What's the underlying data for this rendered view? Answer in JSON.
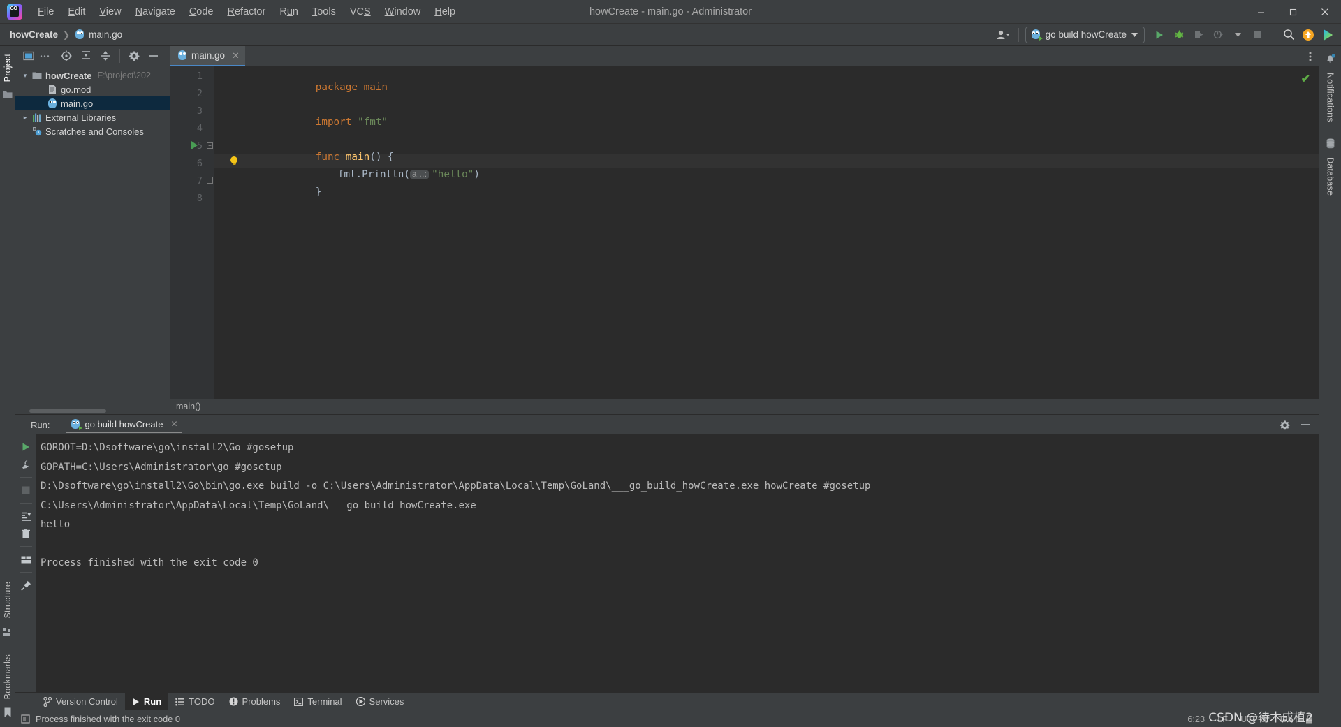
{
  "window": {
    "title": "howCreate - main.go - Administrator",
    "controls": {
      "minimize": "—",
      "maximize": "❐",
      "close": "✕"
    }
  },
  "menubar": {
    "logo_text": "GO",
    "items": [
      {
        "label": "File",
        "mnemonic": "F"
      },
      {
        "label": "Edit",
        "mnemonic": "E"
      },
      {
        "label": "View",
        "mnemonic": "V"
      },
      {
        "label": "Navigate",
        "mnemonic": "N"
      },
      {
        "label": "Code",
        "mnemonic": "C"
      },
      {
        "label": "Refactor",
        "mnemonic": "R"
      },
      {
        "label": "Run",
        "mnemonic": "u"
      },
      {
        "label": "Tools",
        "mnemonic": "T"
      },
      {
        "label": "VCS",
        "mnemonic": "S"
      },
      {
        "label": "Window",
        "mnemonic": "W"
      },
      {
        "label": "Help",
        "mnemonic": "H"
      }
    ]
  },
  "navbar": {
    "breadcrumbs": [
      {
        "label": "howCreate",
        "icon": "none"
      },
      {
        "label": "main.go",
        "icon": "go-file-icon"
      }
    ],
    "run_configuration": {
      "label": "go build howCreate",
      "icon": "go-run-config-icon"
    },
    "actions": [
      "account-icon",
      "run-icon",
      "debug-icon",
      "run-with-coverage-icon",
      "profile-icon",
      "stop-icon",
      "search-everywhere-icon",
      "update-icon",
      "ide-features-icon"
    ]
  },
  "left_stripe": {
    "top": [
      {
        "label": "Project",
        "active": true,
        "icon": "project-icon"
      }
    ],
    "bottom": [
      {
        "label": "Structure",
        "icon": "structure-icon"
      },
      {
        "label": "Bookmarks",
        "icon": "bookmarks-icon"
      }
    ]
  },
  "right_stripe": {
    "items": [
      {
        "label": "Notifications",
        "icon": "bell-icon",
        "badge": true
      },
      {
        "label": "Database",
        "icon": "database-icon"
      }
    ]
  },
  "project_panel": {
    "toolbar": [
      "select-opened-file-icon",
      "ellipsis-icon",
      "scroll-from-source-icon",
      "expand-all-icon",
      "collapse-all-icon",
      "settings-icon",
      "hide-icon"
    ],
    "tree": [
      {
        "label": "howCreate",
        "path": "F:\\project\\202",
        "icon": "folder-icon",
        "indent": 0,
        "expanded": true,
        "bold": true,
        "selected": false
      },
      {
        "label": "go.mod",
        "path": "",
        "icon": "go-mod-icon",
        "indent": 1,
        "expanded": null,
        "bold": false,
        "selected": false
      },
      {
        "label": "main.go",
        "path": "",
        "icon": "go-file-icon",
        "indent": 1,
        "expanded": null,
        "bold": false,
        "selected": true
      },
      {
        "label": "External Libraries",
        "path": "",
        "icon": "libraries-icon",
        "indent": 0,
        "expanded": false,
        "bold": false,
        "selected": false
      },
      {
        "label": "Scratches and Consoles",
        "path": "",
        "icon": "scratches-icon",
        "indent": 0,
        "expanded": null,
        "bold": false,
        "selected": false
      }
    ]
  },
  "editor": {
    "tab": {
      "label": "main.go",
      "icon": "go-file-icon",
      "close": "✕"
    },
    "more_icon": "more-vertical-icon",
    "inspection_status": "✔",
    "breadcrumb": "main()",
    "line_numbers": [
      "1",
      "2",
      "3",
      "4",
      "5",
      "6",
      "7",
      "8"
    ],
    "lines": [
      {
        "n": 1,
        "tokens": [
          {
            "t": "package ",
            "c": "kw"
          },
          {
            "t": "main",
            "c": "kw"
          }
        ]
      },
      {
        "n": 2,
        "tokens": []
      },
      {
        "n": 3,
        "tokens": [
          {
            "t": "import ",
            "c": "kw"
          },
          {
            "t": "\"fmt\"",
            "c": "str"
          }
        ]
      },
      {
        "n": 4,
        "tokens": []
      },
      {
        "n": 5,
        "tokens": [
          {
            "t": "func ",
            "c": "kw"
          },
          {
            "t": "main",
            "c": "fn"
          },
          {
            "t": "() {",
            "c": "pl"
          }
        ]
      },
      {
        "n": 6,
        "tokens": [
          {
            "t": "    fmt.Println(",
            "c": "id"
          },
          {
            "t": " a…: ",
            "c": "hint"
          },
          {
            "t": "\"hello\"",
            "c": "str"
          },
          {
            "t": ")",
            "c": "pl"
          }
        ]
      },
      {
        "n": 7,
        "tokens": [
          {
            "t": "}",
            "c": "pl"
          }
        ]
      },
      {
        "n": 8,
        "tokens": []
      }
    ],
    "code_text": {
      "l1": "package main",
      "l3_kw": "import ",
      "l3_str": "\"fmt\"",
      "l5_kw": "func ",
      "l5_fn": "main",
      "l5_pl": "() {",
      "l6_pre": "fmt.Println(",
      "l6_hint": "a…:",
      "l6_str": "\"hello\"",
      "l6_post": ")",
      "l7": "}"
    }
  },
  "run_panel": {
    "label": "Run:",
    "tab": {
      "label": "go build howCreate",
      "icon": "go-run-config-icon",
      "close": "✕"
    },
    "header_actions": [
      "settings-icon",
      "hide-icon"
    ],
    "gutter_actions": [
      "rerun-icon",
      "wrench-icon",
      "stop-icon",
      "scroll-to-end-icon",
      "trash-icon",
      "soft-wrap-icon",
      "pin-icon"
    ],
    "console_lines": [
      "GOROOT=D:\\Dsoftware\\go\\install2\\Go #gosetup",
      "GOPATH=C:\\Users\\Administrator\\go #gosetup",
      "D:\\Dsoftware\\go\\install2\\Go\\bin\\go.exe build -o C:\\Users\\Administrator\\AppData\\Local\\Temp\\GoLand\\___go_build_howCreate.exe howCreate #gosetup",
      "C:\\Users\\Administrator\\AppData\\Local\\Temp\\GoLand\\___go_build_howCreate.exe",
      "hello",
      "",
      "Process finished with the exit code 0"
    ]
  },
  "tool_tabs": [
    {
      "label": "Version Control",
      "icon": "branch-icon",
      "active": false
    },
    {
      "label": "Run",
      "icon": "run-icon",
      "active": true
    },
    {
      "label": "TODO",
      "icon": "todo-icon",
      "active": false
    },
    {
      "label": "Problems",
      "icon": "problems-icon",
      "active": false
    },
    {
      "label": "Terminal",
      "icon": "terminal-icon",
      "active": false
    },
    {
      "label": "Services",
      "icon": "services-icon",
      "active": false
    }
  ],
  "statusbar": {
    "message": "Process finished with the exit code 0",
    "message_icon": "console-icon",
    "position": "6:23",
    "line_separator": "LF",
    "encoding": "UTF-8",
    "indent": "Tab",
    "lock_icon": "lock-icon"
  },
  "watermark": "CSDN @待木成植2",
  "colors": {
    "accent_blue": "#4a88c7",
    "selection": "#0d293e",
    "keyword": "#cc7832",
    "string": "#6a8759",
    "function": "#ffc66d",
    "plain": "#a9b7c6",
    "run_green": "#499c54",
    "panel_bg": "#3c3f41",
    "editor_bg": "#2b2b2b",
    "gutter_bg": "#313335"
  }
}
